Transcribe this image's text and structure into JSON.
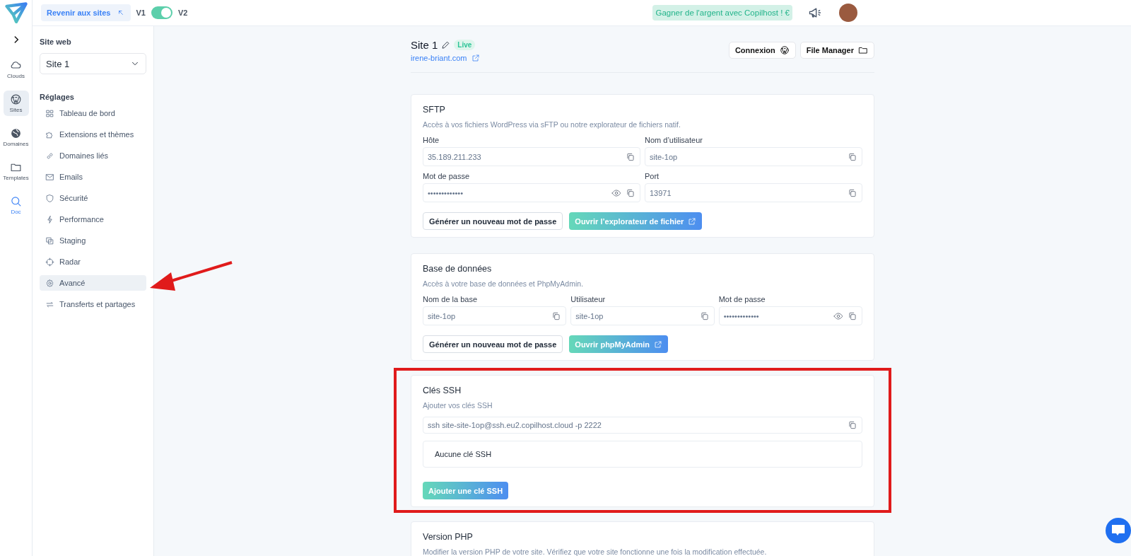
{
  "topbar": {
    "back_button": "Revenir aux sites",
    "toggle": {
      "left": "V1",
      "right": "V2",
      "on": true
    },
    "promo": "Gagner de l'argent avec Copilhost ! €"
  },
  "rail": {
    "items": [
      {
        "label": "Clouds",
        "kind": "nav",
        "selected": false
      },
      {
        "label": "Sites",
        "kind": "nav",
        "selected": true
      },
      {
        "label": "Domaines",
        "kind": "nav",
        "selected": false
      },
      {
        "label": "Templates",
        "kind": "nav",
        "selected": false
      },
      {
        "label": "Doc",
        "kind": "link",
        "selected": false
      }
    ]
  },
  "sidebar": {
    "site_label": "Site web",
    "site_select": "Site 1",
    "section": "Réglages",
    "items": [
      {
        "label": "Tableau de bord",
        "selected": false,
        "annotated": false
      },
      {
        "label": "Extensions et thèmes",
        "selected": false,
        "annotated": false
      },
      {
        "label": "Domaines liés",
        "selected": false,
        "annotated": false
      },
      {
        "label": "Emails",
        "selected": false,
        "annotated": false
      },
      {
        "label": "Sécurité",
        "selected": false,
        "annotated": false
      },
      {
        "label": "Performance",
        "selected": false,
        "annotated": false
      },
      {
        "label": "Staging",
        "selected": false,
        "annotated": false
      },
      {
        "label": "Radar",
        "selected": false,
        "annotated": false
      },
      {
        "label": "Avancé",
        "selected": true,
        "annotated": true
      },
      {
        "label": "Transferts et partages",
        "selected": false,
        "annotated": false
      }
    ]
  },
  "header": {
    "title": "Site 1",
    "status": "Live",
    "url": "irene-briant.com",
    "buttons": [
      {
        "label": "Connexion"
      },
      {
        "label": "File Manager"
      }
    ]
  },
  "sections": [
    {
      "title": "SFTP",
      "description": "Accès à vos fichiers WordPress via sFTP ou notre explorateur de fichiers natif.",
      "highlighted": false,
      "fields": [
        {
          "label": "Hôte",
          "value": "35.189.211.233",
          "kind": "text"
        },
        {
          "label": "Nom d’utilisateur",
          "value": "site-1op",
          "kind": "text"
        },
        {
          "label": "Mot de passe",
          "value": "•••••••••••••",
          "kind": "password"
        },
        {
          "label": "Port",
          "value": "13971",
          "kind": "text"
        }
      ],
      "buttons": [
        {
          "label": "Générer un nouveau mot de passe",
          "kind": "secondary",
          "external": false
        },
        {
          "label": "Ouvrir l’explorateur de fichier",
          "kind": "primary",
          "external": true
        }
      ]
    },
    {
      "title": "Base de données",
      "description": "Accès à votre base de données et PhpMyAdmin.",
      "highlighted": false,
      "fields": [
        {
          "label": "Nom de la base",
          "value": "site-1op",
          "kind": "text"
        },
        {
          "label": "Utilisateur",
          "value": "site-1op",
          "kind": "text"
        },
        {
          "label": "Mot de passe",
          "value": "•••••••••••••",
          "kind": "password"
        }
      ],
      "buttons": [
        {
          "label": "Générer un nouveau mot de passe",
          "kind": "secondary",
          "external": false
        },
        {
          "label": "Ouvrir phpMyAdmin",
          "kind": "primary",
          "external": true
        }
      ]
    },
    {
      "title": "Clés SSH",
      "description": "Ajouter vos clés SSH",
      "highlighted": true,
      "command": "ssh site-site-1op@ssh.eu2.copilhost.cloud -p 2222",
      "empty_message": "Aucune clé SSH",
      "buttons": [
        {
          "label": "Ajouter une clé SSH",
          "kind": "primary",
          "external": false
        }
      ]
    },
    {
      "title": "Version PHP",
      "description": "Modifier la version PHP de votre site. Vérifiez que votre site fonctionne une fois la modification effectuée.",
      "highlighted": false
    }
  ]
}
